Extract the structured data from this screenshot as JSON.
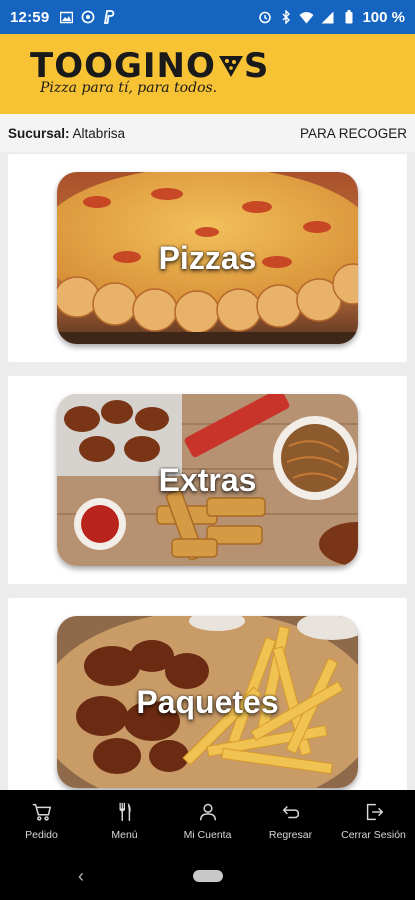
{
  "status": {
    "time": "12:59",
    "battery": "100 %",
    "left_icons": [
      "image-icon",
      "whatsapp-icon",
      "paypal-icon"
    ],
    "right_icons": [
      "alarm-icon",
      "bluetooth-icon",
      "wifi-icon",
      "signal-icon",
      "battery-icon"
    ]
  },
  "header": {
    "brand": "TOOGINO'S",
    "brand_main": "TOOGINO",
    "brand_tail": "S",
    "tagline": "Pizza para tí, para todos.",
    "accent": "#f8c235"
  },
  "branch": {
    "label": "Sucursal:",
    "value": "Altabrisa",
    "mode": "PARA RECOGER"
  },
  "categories": [
    {
      "label": "Pizzas"
    },
    {
      "label": "Extras"
    },
    {
      "label": "Paquetes"
    }
  ],
  "nav": [
    {
      "label": "Pedido",
      "icon": "cart-icon"
    },
    {
      "label": "Menú",
      "icon": "utensils-icon"
    },
    {
      "label": "Mi Cuenta",
      "icon": "user-icon"
    },
    {
      "label": "Regresar",
      "icon": "return-icon"
    },
    {
      "label": "Cerrar Sesión",
      "icon": "logout-icon"
    }
  ],
  "colors": {
    "status_bar": "#1565c0",
    "nav_bg": "#000000",
    "page_bg": "#ececec"
  }
}
